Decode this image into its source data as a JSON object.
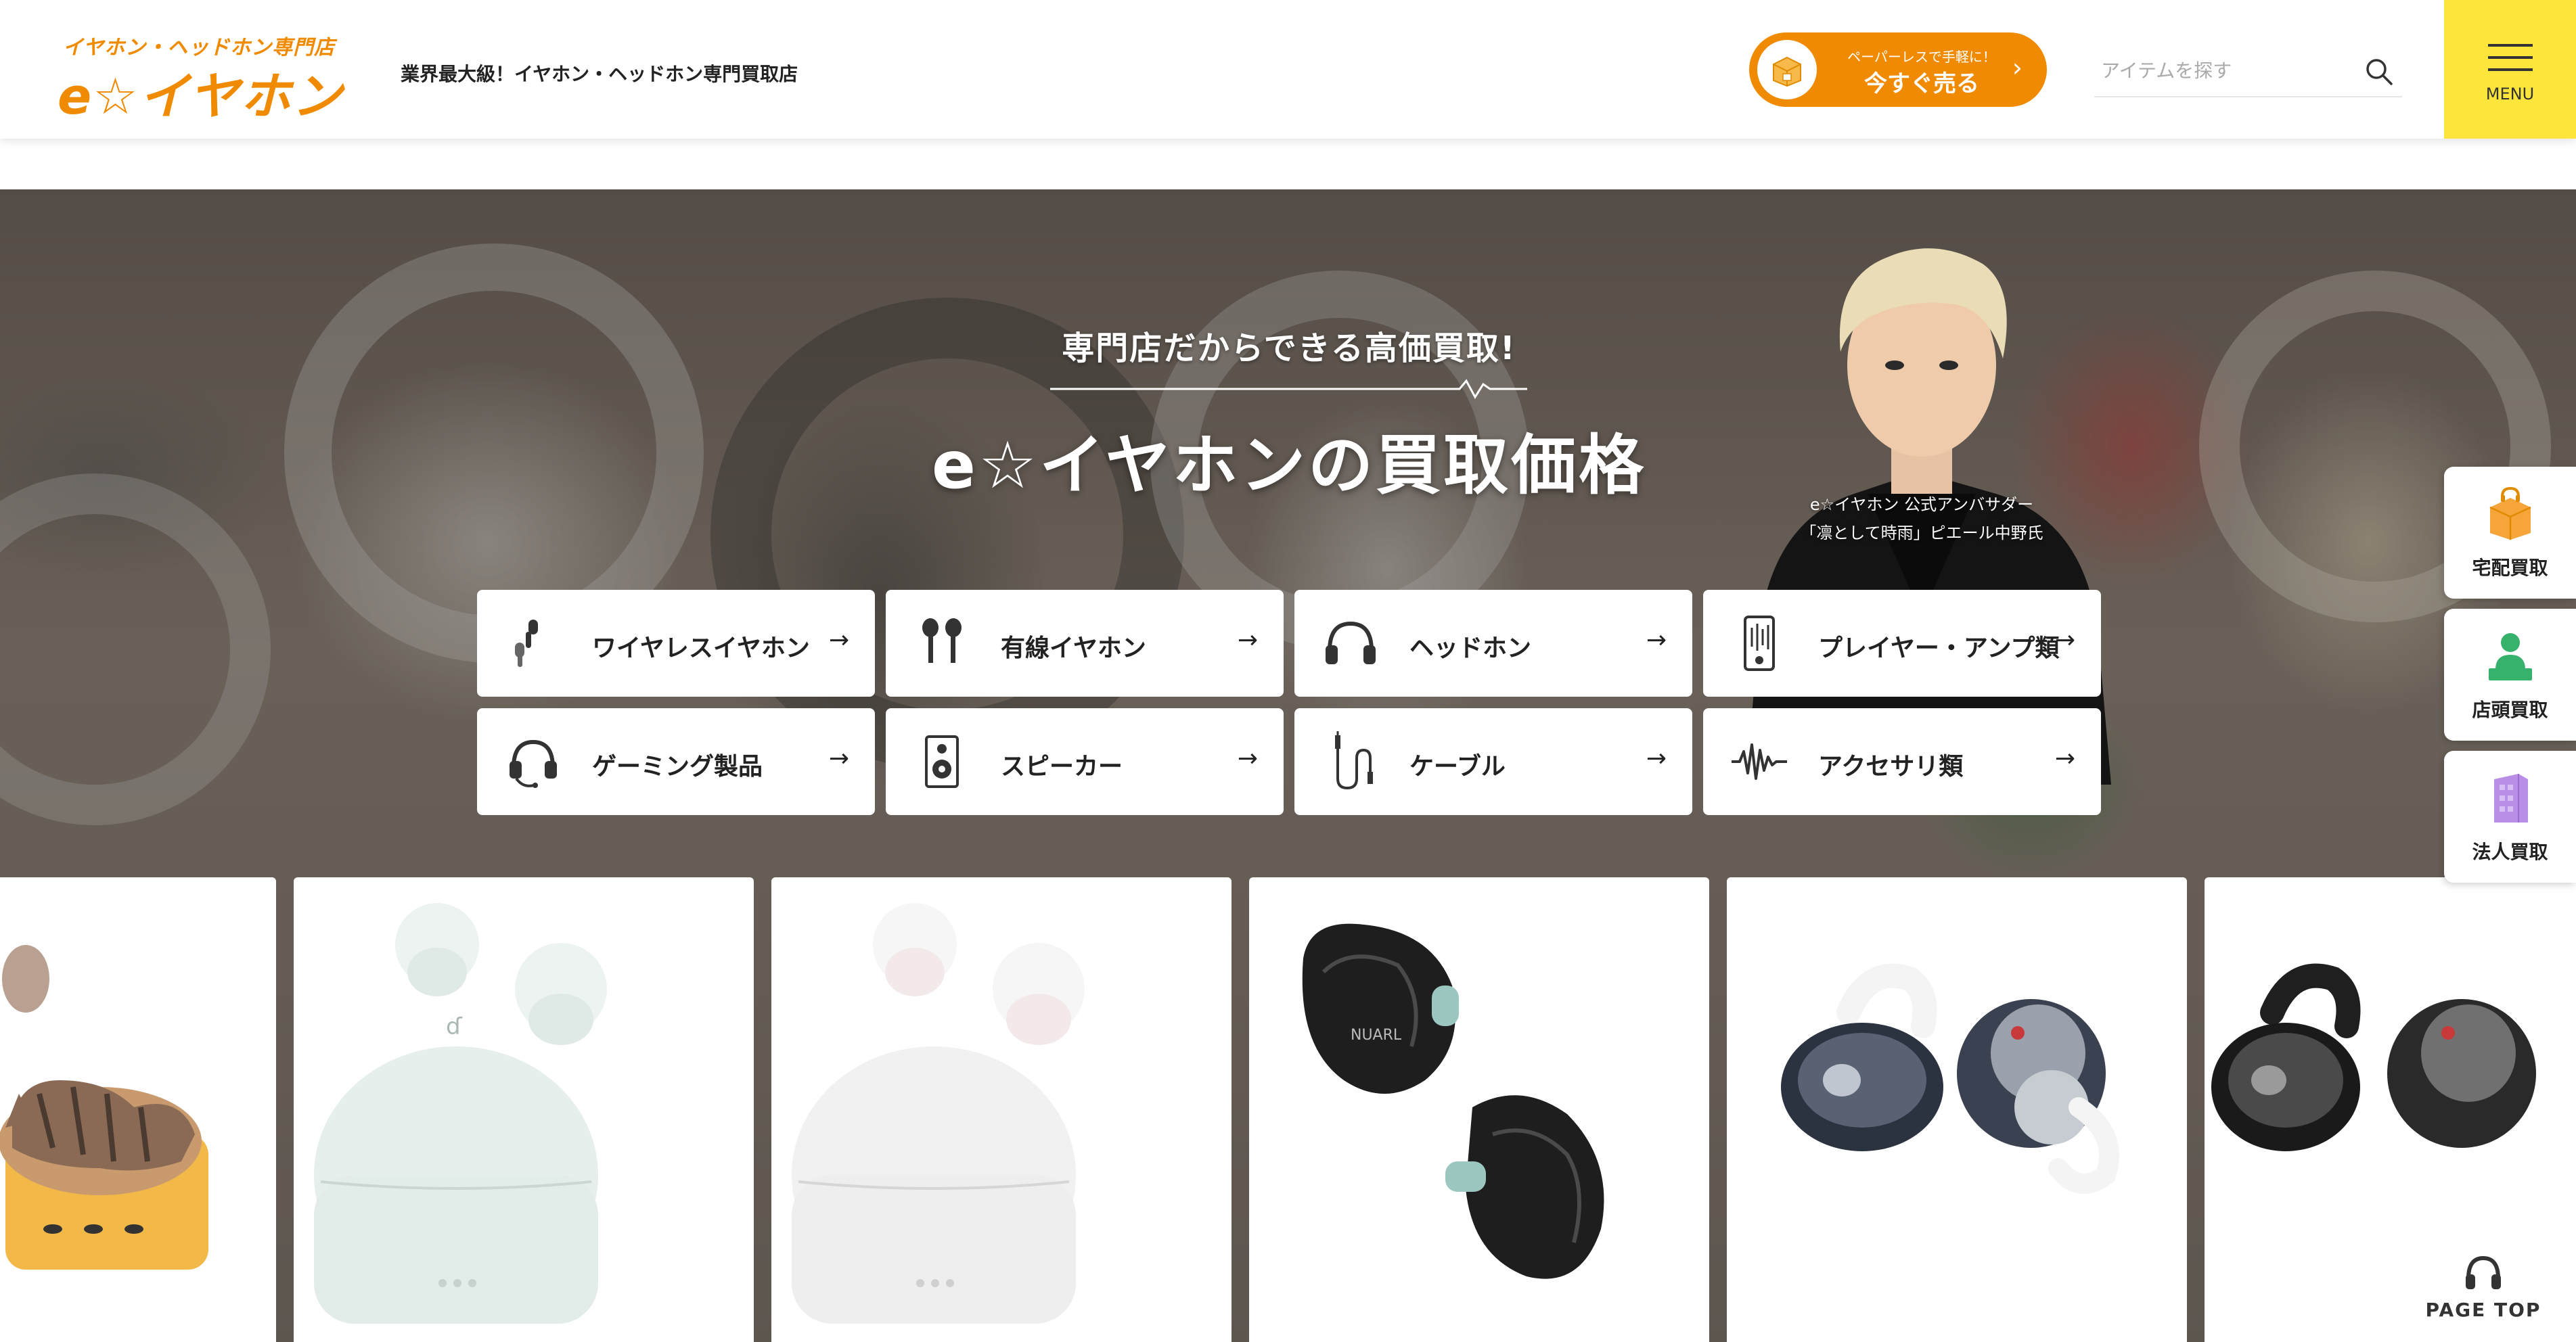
{
  "header": {
    "logo_small": "イヤホン・ヘッドホン専門店",
    "logo_main": "e☆イヤホン",
    "tagline": "業界最大級！イヤホン・ヘッドホン専門買取店",
    "sell_button": {
      "small": "ペーパーレスで手軽に！",
      "main": "今すぐ売る"
    },
    "search": {
      "placeholder": "アイテムを探す"
    },
    "menu_label": "MENU"
  },
  "hero": {
    "subtitle": "専門店だからできる高価買取!",
    "title": "e☆イヤホンの買取価格",
    "ambassador_caption_line1": "e☆イヤホン 公式アンバサダー",
    "ambassador_caption_line2": "「凛として時雨」ピエール中野氏"
  },
  "categories": [
    {
      "label": "ワイヤレスイヤホン",
      "icon": "wireless-earbuds-icon"
    },
    {
      "label": "有線イヤホン",
      "icon": "wired-earphones-icon"
    },
    {
      "label": "ヘッドホン",
      "icon": "headphones-icon"
    },
    {
      "label": "プレイヤー・アンプ類",
      "icon": "player-icon"
    },
    {
      "label": "ゲーミング製品",
      "icon": "gaming-headset-icon"
    },
    {
      "label": "スピーカー",
      "icon": "speaker-icon"
    },
    {
      "label": "ケーブル",
      "icon": "cable-icon"
    },
    {
      "label": "アクセサリ類",
      "icon": "waveform-icon"
    }
  ],
  "products": [
    {
      "name": "cat-earphone-stand"
    },
    {
      "name": "white-mint-earbuds"
    },
    {
      "name": "white-earbuds"
    },
    {
      "name": "nuarl-black-iem"
    },
    {
      "name": "open-ear-clear-white"
    },
    {
      "name": "open-ear-clear-black"
    }
  ],
  "side_nav": [
    {
      "label": "宅配買取",
      "icon": "delivery-box-icon"
    },
    {
      "label": "店頭買取",
      "icon": "store-clerk-icon"
    },
    {
      "label": "法人買取",
      "icon": "building-icon"
    }
  ],
  "page_top": {
    "label": "PAGE TOP"
  },
  "colors": {
    "brand_orange": "#f08a00",
    "menu_yellow": "#fde53b"
  }
}
